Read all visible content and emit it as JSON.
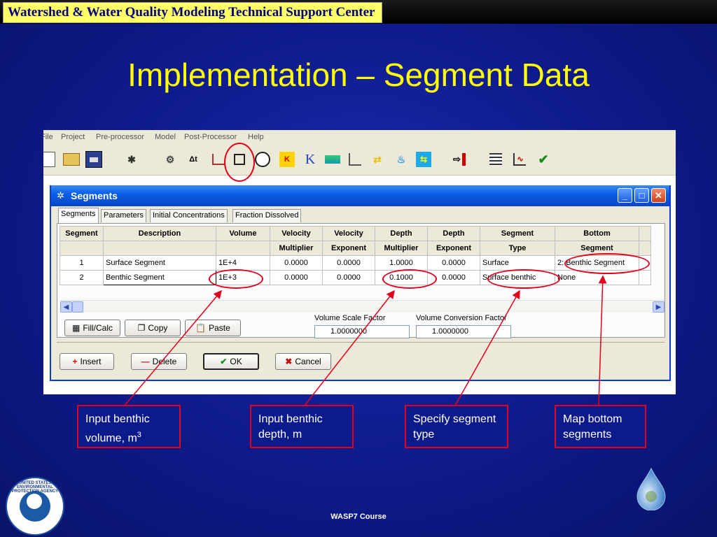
{
  "header": {
    "label": "Watershed & Water Quality Modeling Technical Support Center"
  },
  "slide": {
    "title": "Implementation – Segment Data",
    "footer": "WASP7 Course"
  },
  "app": {
    "menu": [
      "File",
      "Project",
      "Pre-processor",
      "Model",
      "Post-Processor",
      "Help"
    ],
    "toolbar_icons": [
      "new-file-icon",
      "open-folder-icon",
      "save-icon",
      "bug-icon",
      "settings-gears-icon",
      "delta-t-icon",
      "time-function-icon",
      "segments-cube-icon",
      "clock-icon",
      "kinetics-icon",
      "k-constants-icon",
      "loads-icon",
      "boundaries-icon",
      "exchange-arrows-icon",
      "tap-icon",
      "flows-icon",
      "execute-arrow-icon",
      "output-grid-icon",
      "graph-icon",
      "check-icon"
    ],
    "toolbar_glyphs": {
      "delta_t": "Δt",
      "k": "K",
      "check": "✔"
    }
  },
  "dialog": {
    "title": "Segments",
    "tabs": [
      "Segments",
      "Parameters",
      "Initial Concentrations",
      "Fraction Dissolved"
    ],
    "table": {
      "headers_top": [
        "Segment",
        "Description",
        "Volume",
        "Velocity",
        "Velocity",
        "Depth",
        "Depth",
        "Segment",
        "Bottom"
      ],
      "headers_bottom": [
        "",
        "",
        "",
        "Multiplier",
        "Exponent",
        "Multiplier",
        "Exponent",
        "Type",
        "Segment"
      ],
      "rows": [
        [
          "1",
          "Surface Segment",
          "1E+4",
          "0.0000",
          "0.0000",
          "1.0000",
          "0.0000",
          "Surface",
          "2: Benthic Segment"
        ],
        [
          "2",
          "Benthic Segment",
          "1E+3",
          "0.0000",
          "0.0000",
          "0.1000",
          "0.0000",
          "Surface benthic",
          "None"
        ]
      ]
    },
    "buttons": {
      "fill_calc": "Fill/Calc",
      "copy": "Copy",
      "paste": "Paste",
      "insert": "Insert",
      "delete": "Delete",
      "ok": "OK",
      "cancel": "Cancel"
    },
    "volume_scale_label": "Volume Scale Factor",
    "volume_scale_value": "1.0000000",
    "volume_conversion_label": "Volume Conversion Factor",
    "volume_conversion_value": "1.0000000"
  },
  "notes": {
    "n1": "Input benthic volume, m",
    "n1_sup": "3",
    "n2": "Input benthic depth, m",
    "n3": "Specify segment type",
    "n4": "Map bottom segments"
  },
  "logo": {
    "epa_text": "UNITED STATES ENVIRONMENTAL PROTECTION AGENCY"
  },
  "colors": {
    "title_yellow": "#ffff00",
    "highlight_red": "#e3001b",
    "background_blue": "#0e1a8a",
    "xp_title_blue": "#0a5fe6"
  }
}
